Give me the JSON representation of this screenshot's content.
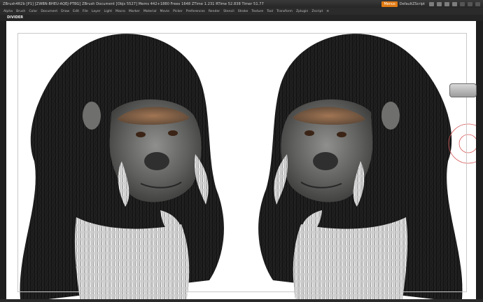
{
  "titlebar": {
    "title": "ZBrush4R2b  [P1] [ZWBN-BHEU-AQEJ-PTBG]    ZBrush Document    [Objs 5527]  Mems 442+1880  Frees 1648  ZTime 1.231  RTime 52.838  Timer 51.77",
    "menus_label": "Menus",
    "script_label": "DefaultZScript"
  },
  "menubar": {
    "items": [
      "Alpha",
      "Brush",
      "Color",
      "Document",
      "Draw",
      "Edit",
      "File",
      "Layer",
      "Light",
      "Macro",
      "Marker",
      "Material",
      "Movie",
      "Picker",
      "Preferences",
      "Render",
      "Stencil",
      "Stroke",
      "Texture",
      "Tool",
      "Transform",
      "Zplugin",
      "Zscript",
      "≡"
    ]
  },
  "document": {
    "label": "DIVIDER"
  },
  "colors": {
    "accent": "#e07a12",
    "canvas": "#ffffff",
    "ui_dark": "#1c1c1c"
  }
}
